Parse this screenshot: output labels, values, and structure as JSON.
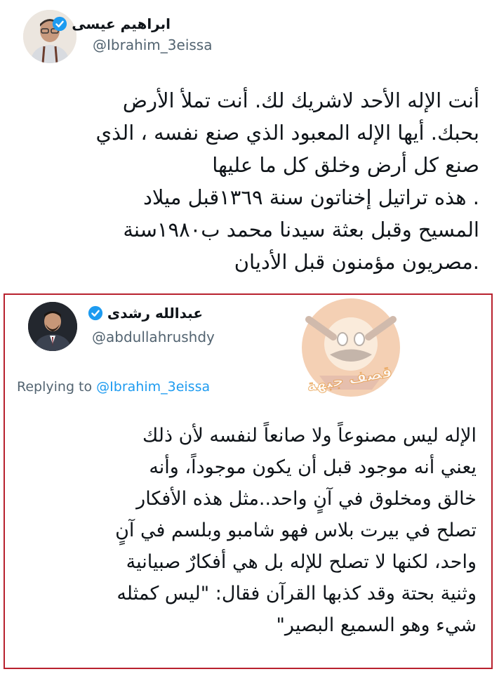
{
  "tweet": {
    "author_name": "ابراهيم عيسى",
    "author_handle": "@Ibrahim_3eissa",
    "lines": [
      "أنت الإله الأحد لاشريك لك. أنت تملأ الأرض",
      "بحبك. أيها الإله المعبود الذي صنع نفسه ، الذي",
      "صنع كل أرض وخلق كل ما عليها",
      ". هذه تراتيل إخناتون سنة ١٣٦٩قبل ميلاد",
      "المسيح وقبل بعثة سيدنا محمد ب١٩٨٠سنة",
      ".مصريون مؤمنون قبل الأديان"
    ]
  },
  "quote": {
    "author_name": "عبدالله رشدى",
    "author_handle": "@abdullahrushdy",
    "replying_prefix": "Replying to",
    "replying_to": "@Ibrahim_3eissa",
    "lines": [
      "الإله ليس مصنوعاً ولا صانعاً لنفسه لأن ذلك",
      "يعني أنه موجود قبل أن يكون موجوداً، وأنه",
      "خالق ومخلوق في آنٍ واحد..مثل هذه الأفكار",
      "تصلح في بيرت بلاس فهو شامبو وبلسم في آنٍ",
      "واحد، لكنها لا تصلح للإله بل هي أفكارٌ صبيانية",
      "وثنية بحتة وقد كذبها القرآن فقال: \"ليس كمثله",
      "شيء وهو السميع البصير\""
    ]
  },
  "watermark": {
    "text": "قصف جبهة"
  },
  "colors": {
    "verified": "#1d9bf0",
    "frame": "#b8212e",
    "handle": "#536471",
    "mention": "#1d9bf0"
  }
}
